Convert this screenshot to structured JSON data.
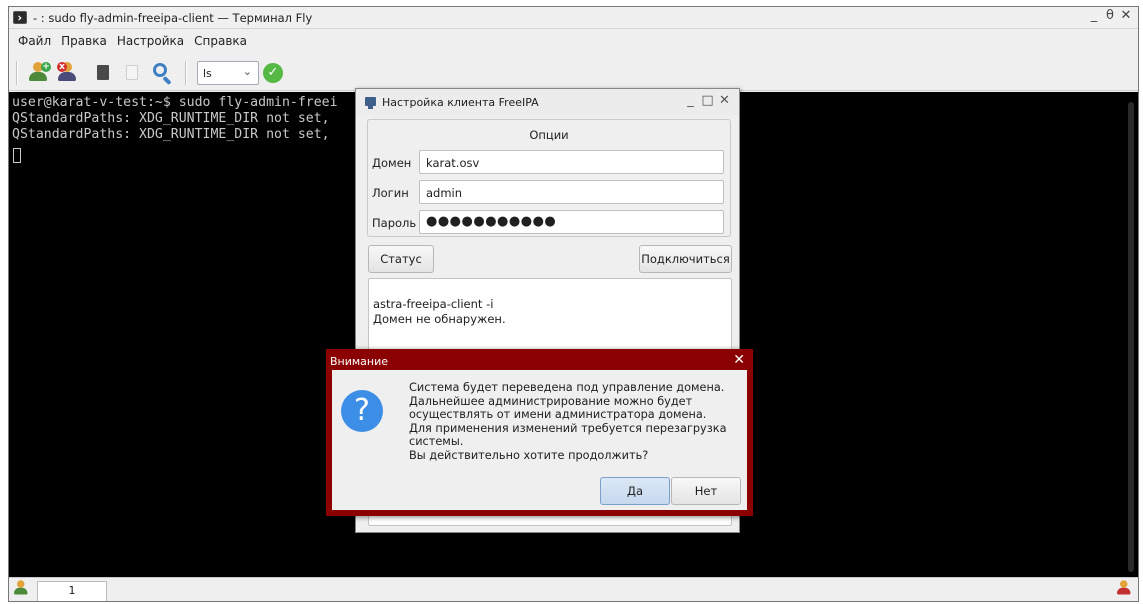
{
  "window": {
    "title": "- : sudo fly-admin-freeipa-client — Терминал Fly",
    "controls": [
      "_",
      "θ",
      "✕"
    ]
  },
  "menubar": {
    "items": [
      "Файл",
      "Правка",
      "Настройка",
      "Справка"
    ]
  },
  "toolbar": {
    "icons": [
      "new-tab-user-icon",
      "close-tab-user-icon",
      "copy-icon",
      "paste-icon",
      "search-icon",
      "ok-icon"
    ],
    "command_combo_value": "ls"
  },
  "terminal": {
    "lines": [
      "user@karat-v-test:~$ sudo fly-admin-freei",
      "QStandardPaths: XDG_RUNTIME_DIR not set,",
      "QStandardPaths: XDG_RUNTIME_DIR not set,"
    ]
  },
  "statusbar": {
    "tab_label": "1"
  },
  "freeipa_dialog": {
    "title": "Настройка клиента FreeIPA",
    "group_title": "Опции",
    "domain_label": "Домен",
    "domain_value": "karat.osv",
    "login_label": "Логин",
    "login_value": "admin",
    "password_label": "Пароль",
    "password_value": "●●●●●●●●●●●",
    "status_button": "Статус",
    "connect_button": "Подключиться",
    "log_lines": [
      "astra-freeipa-client -i",
      "Домен не обнаружен."
    ]
  },
  "warning_dialog": {
    "title": "Внимание",
    "close": "✕",
    "icon": "question-icon",
    "message_lines": [
      "Система будет переведена под управление домена.",
      "Дальнейшее администрирование можно будет",
      "осуществлять от имени администратора домена.",
      "Для применения изменений требуется перезагрузка",
      "системы.",
      "Вы действительно хотите продолжить?"
    ],
    "yes_button": "Да",
    "no_button": "Нет"
  },
  "colors": {
    "terminal_bg": "#000000",
    "terminal_fg": "#c8c8c8",
    "warning_frame": "#8b0000",
    "question_icon": "#3d8ee6",
    "ok_icon": "#56b845"
  }
}
